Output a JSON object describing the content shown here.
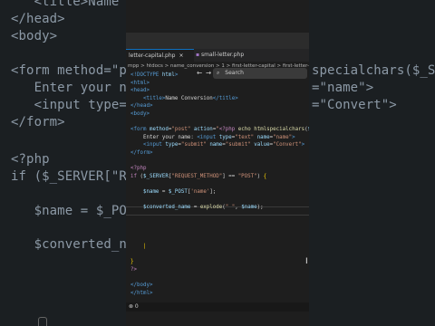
{
  "background": {
    "lines": [
      "   <title>Name Co",
      "</head>",
      "<body>",
      "",
      "<form method=\"pos",
      "   Enter your na",
      "   <input type=",
      "</form>",
      "",
      "<?php",
      "if ($_SERVER[\"RE",
      "",
      "   $name = $_POS",
      "",
      "   $converted_na"
    ],
    "right_lines": [
      "specialchars($_SER",
      "=\"name\">",
      "=\"Convert\">"
    ]
  },
  "editor": {
    "search_label": "Search",
    "tabs": [
      {
        "label": "letter-capital.php",
        "active": true
      },
      {
        "label": "small-letter.php",
        "active": false
      }
    ],
    "breadcrumb": "mpp > htdocs > name_conversion > 1 > first-letter-capital > first-letter-capital.php",
    "status": "⊗ 0"
  }
}
